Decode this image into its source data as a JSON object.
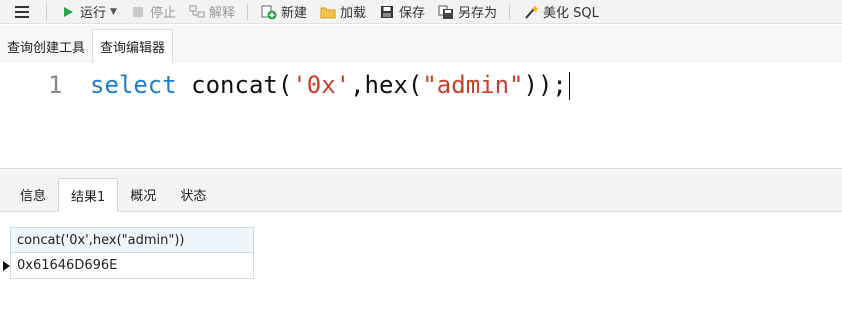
{
  "toolbar": {
    "run_label": "运行",
    "stop_label": "停止",
    "explain_label": "解释",
    "new_label": "新建",
    "load_label": "加载",
    "save_label": "保存",
    "save_as_label": "另存为",
    "beautify_label": "美化 SQL"
  },
  "editor_tabs": [
    {
      "label": "查询创建工具",
      "active": false
    },
    {
      "label": "查询编辑器",
      "active": true
    }
  ],
  "editor": {
    "line_number": "1",
    "keyword": "select",
    "code_part1": " concat(",
    "string1": "'0x'",
    "code_part2": ",hex(",
    "string2": "\"admin\"",
    "code_part3": "));"
  },
  "result_tabs": [
    {
      "label": "信息",
      "active": false
    },
    {
      "label": "结果1",
      "active": true
    },
    {
      "label": "概况",
      "active": false
    },
    {
      "label": "状态",
      "active": false
    }
  ],
  "result_grid": {
    "columns": [
      "concat('0x',hex(\"admin\"))"
    ],
    "rows": [
      [
        "0x61646D696E"
      ]
    ]
  },
  "colors": {
    "keyword": "#1a7fd0",
    "string": "#c8402c",
    "run_icon": "#2aa34a",
    "stop_icon": "#c9c9c9"
  },
  "icons": {
    "menu": "hamburger-icon",
    "run": "play-icon",
    "stop": "stop-icon",
    "explain": "explain-icon",
    "new": "new-icon",
    "load": "load-folder-icon",
    "save": "save-icon",
    "save_as": "save-as-icon",
    "beautify": "magic-wand-icon"
  }
}
